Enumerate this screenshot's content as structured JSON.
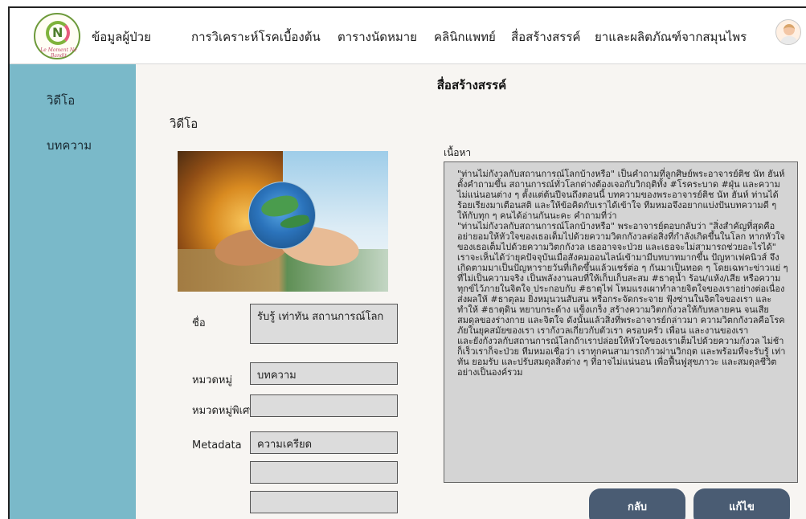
{
  "header": {
    "logo_text": "Le Moment Ne Bandit",
    "nav": [
      "ข้อมูลผู้ป่วย",
      "การวิเคราะห์โรคเบื้องต้น",
      "ตารางนัดหมาย",
      "คลินิกแพทย์",
      "สื่อสร้างสรรค์",
      "ยาและผลิตภัณฑ์จากสมุนไพร"
    ]
  },
  "sidebar": {
    "items": [
      "วิดีโอ",
      "บทความ"
    ]
  },
  "page": {
    "title": "สื่อสร้างสรรค์",
    "section_title": "วิดีโอ"
  },
  "form": {
    "name_label": "ชื่อ",
    "name_value": "รับรู้ เท่าทัน สถานการณ์โลก",
    "category_label": "หมวดหมู่",
    "category_value": "บทความ",
    "special_category_label": "หมวดหมู่พิเศษ",
    "special_category_value": "",
    "metadata_label": "Metadata",
    "metadata_value": "ความเครียด",
    "extra_value_1": "",
    "extra_value_2": ""
  },
  "content": {
    "label": "เนื้อหา",
    "text": "\"ท่านไม่กังวลกับสถานการณ์โลกบ้างหรือ\" เป็นคำถามที่ลูกศิษย์พระอาจารย์ติช นัท ฮันห์ ตั้งคำถามขึ้น สถานการณ์ทั่วโลกต่างต้องเจอกับวิกฤติทั้ง #โรคระบาด #ฝุ่น และความไม่แน่นอนต่าง ๆ ตั้งแต่ต้นปีจนถึงตอนนี้ บทความของพระอาจารย์ติช นัท ฮันห์ ท่านได้ร้อยเรียงมาเตือนสติ และให้ข้อคิดกับเราได้เข้าใจ ทีมหมอจึงอยากแบ่งปันบทความดี ๆ ให้กับทุก ๆ คนได้อ่านกันนะคะ คำถามที่ว่า\n\"ท่านไม่กังวลกับสถานการณ์โลกบ้างหรือ\" พระอาจารย์ตอบกลับว่า \"สิ่งสำคัญที่สุดคือ อย่ายอมให้หัวใจของเธอเต็มไปด้วยความวิตกกังวลต่อสิ่งที่กำลังเกิดขึ้นในโลก หากหัวใจของเธอเต็มไปด้วยความวิตกกังวล เธออาจจะป่วย และเธอจะไม่สามารถช่วยอะไรได้\"\nเราจะเห็นได้ว่ายุคปัจจุบันเมื่อสังคมออนไลน์เข้ามามีบทบาทมากขึ้น ปัญหาเฟคนิวส์ จึงเกิดตามมาเป็นปัญหารายวันที่เกิดขึ้นแล้วแชร์ต่อ ๆ กันมาเป็นทอด ๆ โดยเฉพาะข่าวแย่ ๆ ที่ไม่เป็นความจริง เป็นพลังงานลบที่ให้เก็บเก็บสะสม #ธาตุน้ำ ร้อน/แห้ง/เสีย หรือความทุกข์ไว้ภายในจิตใจ ประกอบกับ #ธาตุไฟ โหมแรงเผาทำลายจิตใจของเราอย่างต่อเนื่อง ส่งผลให้ #ธาตุลม ยิ่งหมุนวนสับสน หรือกระจัดกระจาย ฟุ้งซ่านในจิตใจของเรา และทำให้ #ธาตุดิน หยาบกระด้าง แข็งเกร็ง สร้างความวิตกกังวลให้กับหลายคน จนเสียสมดุลของร่างกาย และจิตใจ ดังนั้นแล้วสิ่งที่พระอาจารย์กล่าวมา ความวิตกกังวลคือโรคภัยในยุคสมัยของเรา เรากังวลเกี่ยวกับตัวเรา ครอบครัว เพื่อน และงานของเรา\nและยังกังวลกับสถานการณ์โลกถ้าเราปล่อยให้หัวใจของเราเต็มไปด้วยความกังวล ไม่ช้าก็เร็วเราก็จะป่วย ทีมหมอเชื่อว่า เราทุกคนสามารถก้าวผ่านวิกฤต และพร้อมที่จะรับรู้ เท่าทัน ยอมรับ และปรับสมดุลสิ่งต่าง ๆ ที่อาจไม่แน่นอน เพื่อฟื้นฟูสุขภาวะ และสมดุลชีวิตอย่างเป็นองค์รวม"
  },
  "actions": {
    "back": "กลับ",
    "edit": "แก้ไข"
  },
  "icons": {
    "logo": "herbal-clinic-logo",
    "profile": "doctor-avatar-icon"
  }
}
